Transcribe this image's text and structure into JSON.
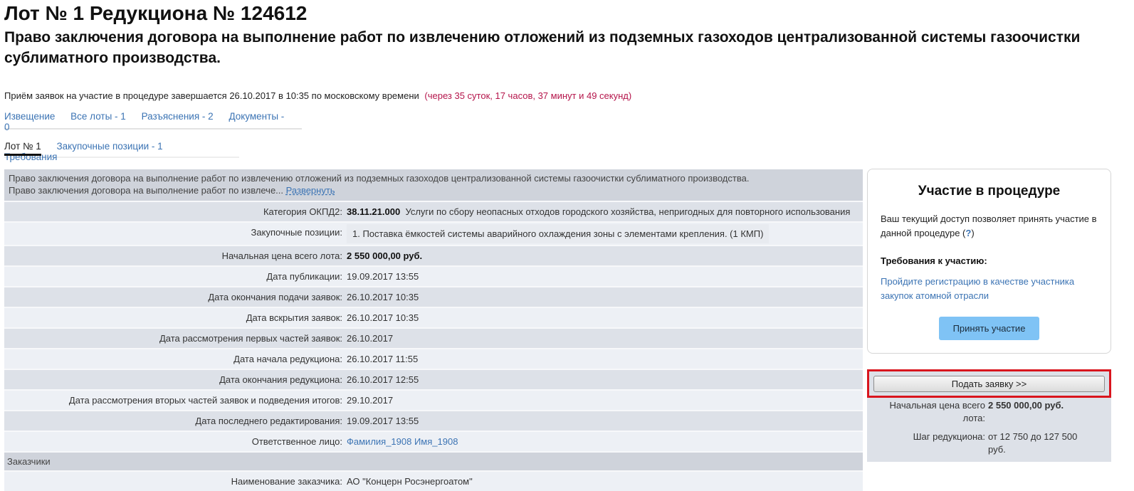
{
  "header": {
    "title": "Лот № 1 Редукциона № 124612",
    "subtitle": "Право заключения договора на выполнение работ по извлечению отложений из подземных газоходов централизованной системы газоочистки сублиматного производства."
  },
  "deadline": {
    "text": "Приём заявок на участие в процедуре завершается 26.10.2017 в 10:35 по московскому времени",
    "countdown": "(через 35 суток, 17 часов, 37 минут и 49 секунд)",
    "countdown_color": "#b5154b"
  },
  "nav_primary": [
    {
      "label": "Извещение"
    },
    {
      "label": "Все лоты - 1"
    },
    {
      "label": "Разъяснения - 2"
    },
    {
      "label": "Документы - 0"
    }
  ],
  "nav_secondary": [
    {
      "label": "Лот № 1",
      "active": true
    },
    {
      "label": "Закупочные позиции - 1"
    },
    {
      "label": "Требования"
    }
  ],
  "lot": {
    "description_line1": "Право заключения договора на выполнение работ по извлечению отложений из подземных газоходов централизованной системы газоочистки сублиматного производства.",
    "description_line2": "Право заключения договора на выполнение работ по извлече...",
    "expand_label": "Развернуть",
    "okpd_label": "Категория ОКПД2:",
    "okpd_code": "38.11.21.000",
    "okpd_text": "Услуги по сбору неопасных отходов городского хозяйства, непригодных для повторного использования",
    "positions_label": "Закупочные позиции:",
    "positions_value": "1. Поставка ёмкостей системы аварийного охлаждения зоны с элементами крепления. (1 КМП)",
    "price_label": "Начальная цена всего лота:",
    "price_value": "2 550 000,00 руб.",
    "fields": [
      {
        "label": "Дата публикации:",
        "value": "19.09.2017 13:55"
      },
      {
        "label": "Дата окончания подачи заявок:",
        "value": "26.10.2017 10:35"
      },
      {
        "label": "Дата вскрытия заявок:",
        "value": "26.10.2017 10:35"
      },
      {
        "label": "Дата рассмотрения первых частей заявок:",
        "value": "26.10.2017"
      },
      {
        "label": "Дата начала редукциона:",
        "value": "26.10.2017 11:55"
      },
      {
        "label": "Дата окончания редукциона:",
        "value": "26.10.2017 12:55"
      },
      {
        "label": "Дата рассмотрения вторых частей заявок и подведения итогов:",
        "value": "29.10.2017"
      },
      {
        "label": "Дата последнего редактирования:",
        "value": "19.09.2017 13:55"
      }
    ],
    "responsible_label": "Ответственное лицо:",
    "responsible_value": "Фамилия_1908 Имя_1908",
    "customers_header": "Заказчики",
    "customer_label": "Наименование заказчика:",
    "customer_value": "АО \"Концерн Росэнергоатом\""
  },
  "participation": {
    "title": "Участие в процедуре",
    "access_text": "Ваш текущий доступ позволяет принять участие в данной процедуре (",
    "help_mark": "?",
    "access_close": ")",
    "requirements_title": "Требования к участию:",
    "requirements_link": "Пройдите регистрацию в качестве участника закупок атомной отрасли",
    "join_button": "Принять участие"
  },
  "bid_panel": {
    "submit_button": "Подать заявку >>",
    "price_label": "Начальная цена всего лота:",
    "price_value": "2 550 000,00 руб.",
    "step_label": "Шаг редукциона:",
    "step_value": "от 12 750 до 127 500 руб."
  }
}
